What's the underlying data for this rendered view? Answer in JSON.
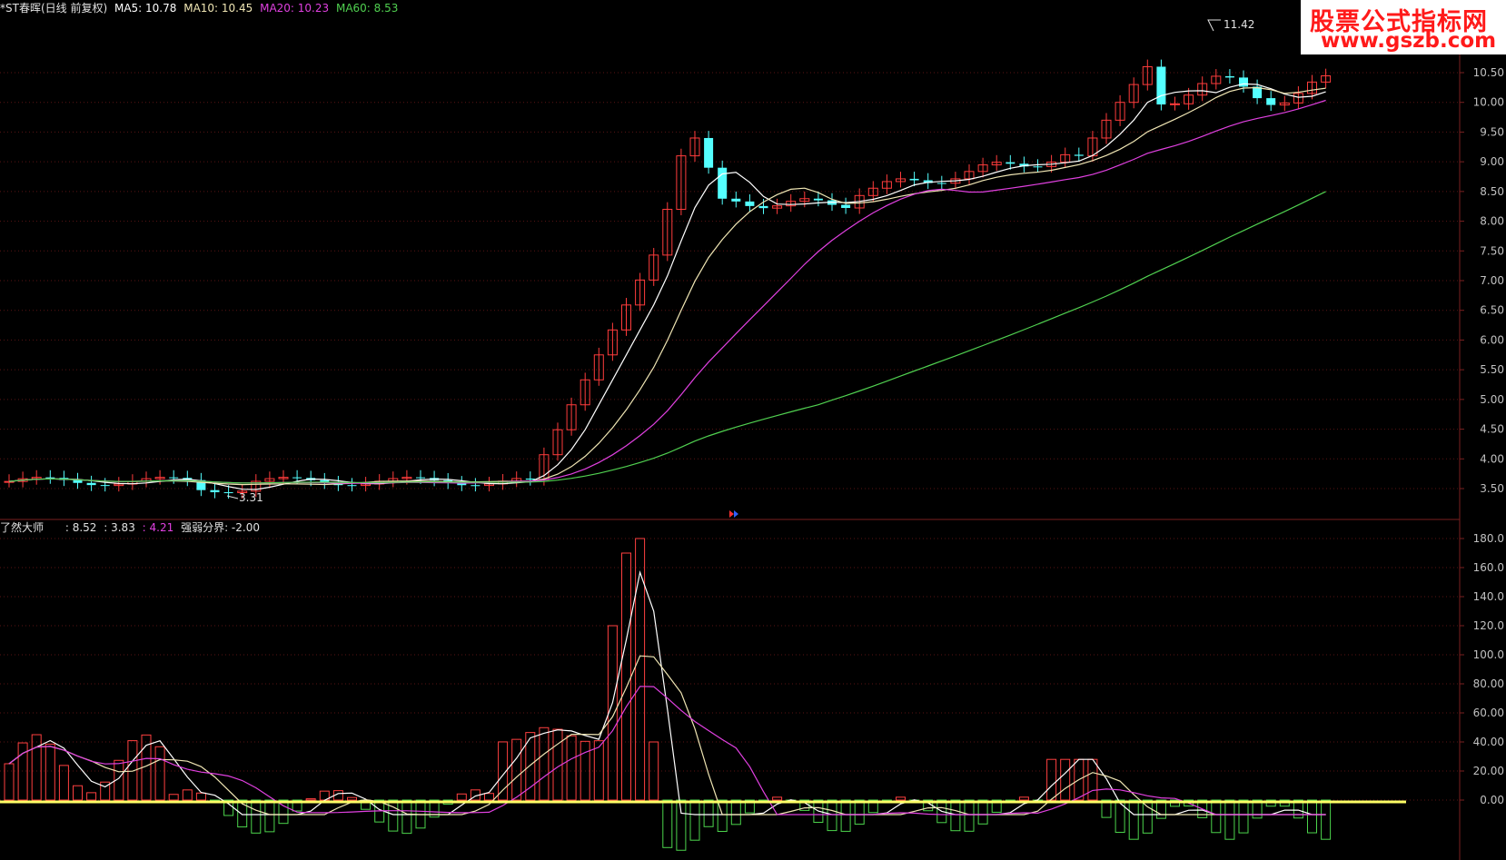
{
  "main_header": {
    "title": "*ST春晖(日线 前复权)",
    "ma5": "MA5: 10.78",
    "ma10": "MA10: 10.45",
    "ma20": "MA20: 10.23",
    "ma60": "MA60: 8.53",
    "colors": {
      "title": "#e0e0e0",
      "ma5": "#ffffff",
      "ma10": "#f0e6b4",
      "ma20": "#e040e0",
      "ma60": "#50d050"
    }
  },
  "indicator_header": {
    "name": "了然大师",
    "v1": ": 8.52",
    "v2": ": 3.83",
    "v3": ": 4.21",
    "v4_label": "强弱分界: -2.00",
    "colors": {
      "name": "#e0e0e0",
      "v1": "#e0e0e0",
      "v2": "#e0e0e0",
      "v3": "#e040e0",
      "v4": "#e0e0e0"
    }
  },
  "watermark": {
    "line1": "股票公式指标网",
    "line2": "www.gszb.com"
  },
  "annotations": {
    "high": "11.42",
    "low": "3.31"
  },
  "chart_data": [
    {
      "type": "candlestick",
      "title": "*ST春晖(日线 前复权)",
      "y_axis_labels": [
        "10.50",
        "10.00",
        "9.50",
        "9.00",
        "8.50",
        "8.00",
        "7.50",
        "7.00",
        "6.50",
        "6.00",
        "5.50",
        "5.00",
        "4.50",
        "4.00",
        "3.50"
      ],
      "ylim": [
        3.3,
        11.5
      ],
      "notable_values": {
        "high": 11.42,
        "low": 3.31
      },
      "ma_last": {
        "MA5": 10.78,
        "MA10": 10.45,
        "MA20": 10.23,
        "MA60": 8.53
      }
    },
    {
      "type": "bar",
      "title": "了然大师",
      "y_axis_labels": [
        "180.0",
        "160.0",
        "140.0",
        "120.0",
        "100.0",
        "80.00",
        "60.00",
        "40.00",
        "20.00",
        "0.00"
      ],
      "ylim": [
        -30,
        185
      ],
      "threshold": -2.0
    }
  ]
}
